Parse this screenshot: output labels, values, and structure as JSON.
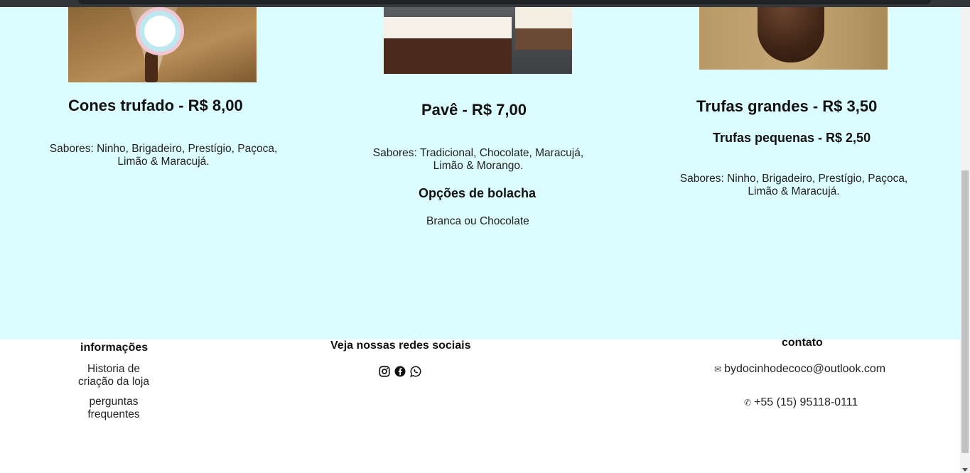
{
  "products": [
    {
      "title": "Cones trufado - R$ 8,00",
      "description": "Sabores: Ninho, Brigadeiro, Prestígio, Paçoca, Limão & Maracujá."
    },
    {
      "title": "Pavê - R$ 7,00",
      "description": "Sabores: Tradicional, Chocolate, Maracujá, Limão & Morango.",
      "options_heading": "Opções de bolacha",
      "options_text": "Branca ou Chocolate"
    },
    {
      "title": "Trufas grandes - R$ 3,50",
      "subtitle": "Trufas pequenas - R$ 2,50",
      "description": "Sabores: Ninho, Brigadeiro, Prestígio, Paçoca, Limão & Maracujá."
    }
  ],
  "footer": {
    "info": {
      "heading": "informações",
      "links": [
        "Historia de criação da loja",
        "perguntas frequentes"
      ]
    },
    "social": {
      "heading": "Veja nossas redes sociais",
      "icons": [
        "instagram-icon",
        "facebook-icon",
        "whatsapp-icon"
      ]
    },
    "contact": {
      "heading": "contato",
      "email": "bydocinhodecoco@outlook.com",
      "phone": "+55 (15) 95118-0111"
    }
  },
  "colors": {
    "products_bg": "#dcfdff",
    "footer_bg": "#ffffff"
  }
}
